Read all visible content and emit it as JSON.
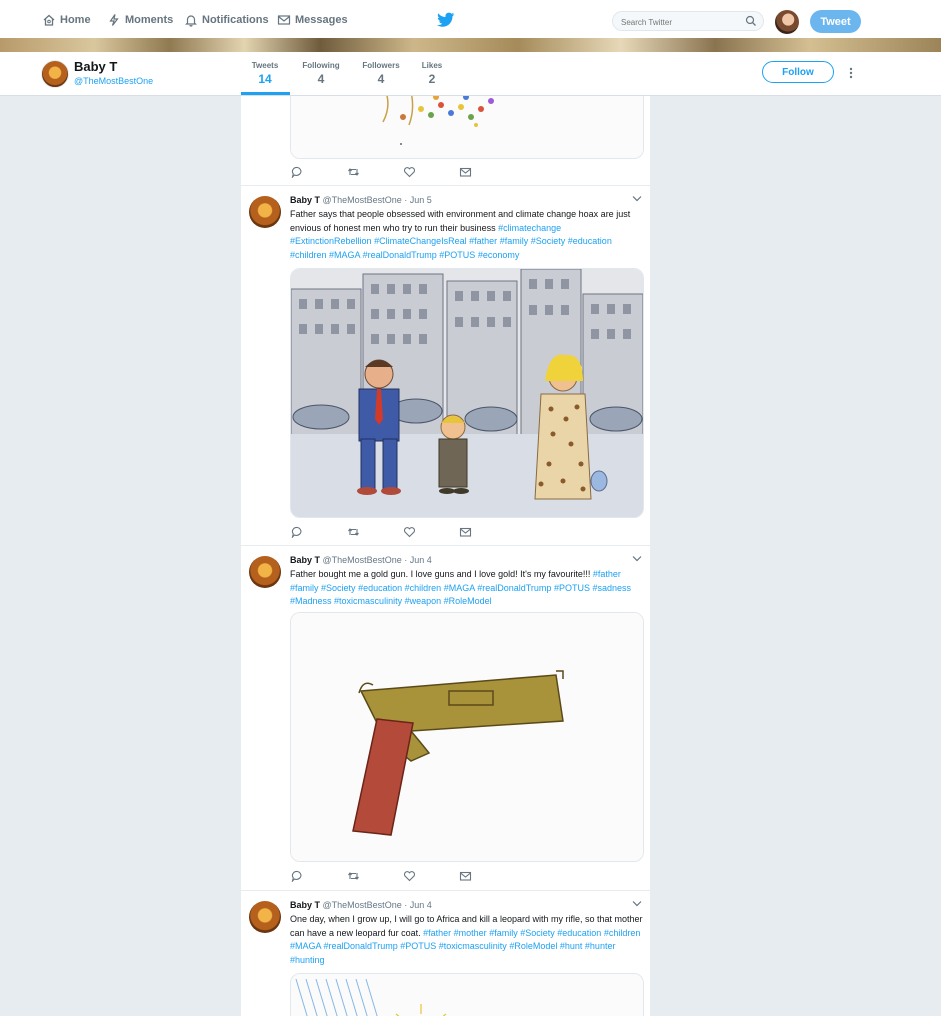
{
  "topnav": {
    "home": "Home",
    "moments": "Moments",
    "notifications": "Notifications",
    "messages": "Messages",
    "search_placeholder": "Search Twitter",
    "tweet_button": "Tweet"
  },
  "profile": {
    "name": "Baby T",
    "handle": "@TheMostBestOne",
    "stats": [
      {
        "label": "Tweets",
        "value": "14"
      },
      {
        "label": "Following",
        "value": "4"
      },
      {
        "label": "Followers",
        "value": "4"
      },
      {
        "label": "Likes",
        "value": "2"
      }
    ],
    "follow_button": "Follow"
  },
  "tweets": [
    {
      "name": "Baby T",
      "handle": "@TheMostBestOne",
      "date": "· Jun 5",
      "segments": [
        {
          "text": "Father says that people obsessed with environment and  climate change hoax are just envious of honest men who try to run their business "
        },
        {
          "text": "#climatechange",
          "tag": true
        },
        {
          "text": " "
        },
        {
          "text": "#ExtinctionRebellion",
          "tag": true
        },
        {
          "text": " "
        },
        {
          "text": "#ClimateChangeIsReal",
          "tag": true
        },
        {
          "text": " "
        },
        {
          "text": "#father",
          "tag": true
        },
        {
          "text": " "
        },
        {
          "text": "#family",
          "tag": true
        },
        {
          "text": " "
        },
        {
          "text": "#Society",
          "tag": true
        },
        {
          "text": " "
        },
        {
          "text": "#education",
          "tag": true
        },
        {
          "text": " "
        },
        {
          "text": "#children",
          "tag": true
        },
        {
          "text": " "
        },
        {
          "text": "#MAGA",
          "tag": true
        },
        {
          "text": " "
        },
        {
          "text": "#realDonaldTrump",
          "tag": true
        },
        {
          "text": " "
        },
        {
          "text": "#POTUS",
          "tag": true
        },
        {
          "text": "  "
        },
        {
          "text": "#economy",
          "tag": true
        }
      ]
    },
    {
      "name": "Baby T",
      "handle": "@TheMostBestOne",
      "date": "· Jun 4",
      "segments": [
        {
          "text": "Father bought me a gold gun. I love guns and I love gold! It's my favourite!!! "
        },
        {
          "text": "#father",
          "tag": true
        },
        {
          "text": " "
        },
        {
          "text": "#family",
          "tag": true
        },
        {
          "text": " "
        },
        {
          "text": "#Society",
          "tag": true
        },
        {
          "text": " "
        },
        {
          "text": "#education",
          "tag": true
        },
        {
          "text": " "
        },
        {
          "text": "#children",
          "tag": true
        },
        {
          "text": " "
        },
        {
          "text": "#MAGA",
          "tag": true
        },
        {
          "text": " "
        },
        {
          "text": "#realDonaldTrump",
          "tag": true
        },
        {
          "text": " "
        },
        {
          "text": "#POTUS",
          "tag": true
        },
        {
          "text": " "
        },
        {
          "text": "#sadness",
          "tag": true
        },
        {
          "text": " "
        },
        {
          "text": "#Madness",
          "tag": true
        },
        {
          "text": " "
        },
        {
          "text": "#toxicmasculinity",
          "tag": true
        },
        {
          "text": " "
        },
        {
          "text": "#weapon",
          "tag": true
        },
        {
          "text": " "
        },
        {
          "text": "#RoleModel",
          "tag": true
        }
      ]
    },
    {
      "name": "Baby T",
      "handle": "@TheMostBestOne",
      "date": "· Jun 4",
      "segments": [
        {
          "text": "One day, when I grow up, I will go to Africa and kill a leopard with my rifle, so that mother can have a new leopard fur coat. "
        },
        {
          "text": "#father",
          "tag": true
        },
        {
          "text": " "
        },
        {
          "text": "#mother",
          "tag": true
        },
        {
          "text": " "
        },
        {
          "text": "#family",
          "tag": true
        },
        {
          "text": " "
        },
        {
          "text": "#Society",
          "tag": true
        },
        {
          "text": " "
        },
        {
          "text": "#education",
          "tag": true
        },
        {
          "text": " "
        },
        {
          "text": "#children",
          "tag": true
        },
        {
          "text": " "
        },
        {
          "text": "#MAGA",
          "tag": true
        },
        {
          "text": " "
        },
        {
          "text": "#realDonaldTrump",
          "tag": true
        },
        {
          "text": " "
        },
        {
          "text": "#POTUS",
          "tag": true
        },
        {
          "text": " "
        },
        {
          "text": "#toxicmasculinity",
          "tag": true
        },
        {
          "text": " "
        },
        {
          "text": "#RoleModel",
          "tag": true
        },
        {
          "text": " "
        },
        {
          "text": "#hunt",
          "tag": true
        },
        {
          "text": " "
        },
        {
          "text": "#hunter",
          "tag": true
        },
        {
          "text": "  "
        },
        {
          "text": "#hunting",
          "tag": true
        }
      ]
    }
  ],
  "colors": {
    "accent": "#1da1f2",
    "background": "#e6ecf0",
    "text_secondary": "#657786"
  }
}
